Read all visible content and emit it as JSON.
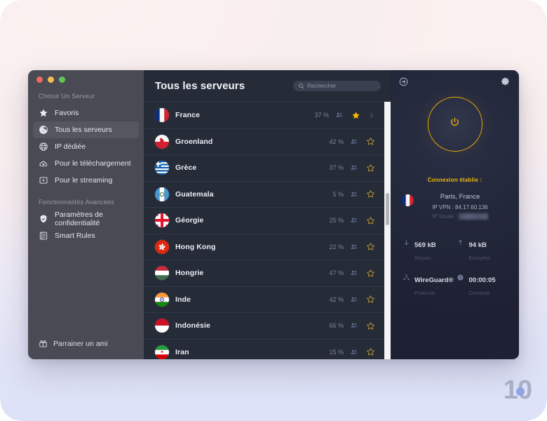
{
  "sidebar": {
    "section_one_title": "Choisir Un Serveur",
    "items_one": [
      {
        "label": "Favoris",
        "icon": "star-icon",
        "active": false
      },
      {
        "label": "Tous les serveurs",
        "icon": "globe-icon",
        "active": true
      },
      {
        "label": "IP dédiée",
        "icon": "dedicated-ip-icon",
        "active": false
      },
      {
        "label": "Pour le téléchargement",
        "icon": "download-cloud-icon",
        "active": false
      },
      {
        "label": "Pour le streaming",
        "icon": "streaming-icon",
        "active": false
      }
    ],
    "section_two_title": "Fonctionnalités Avancées",
    "items_two": [
      {
        "label": "Paramètres de confidentialité",
        "icon": "shield-icon",
        "active": false
      },
      {
        "label": "Smart Rules",
        "icon": "rules-icon",
        "active": false
      }
    ],
    "refer_label": "Parrainer un ami",
    "refer_icon": "gift-icon"
  },
  "main": {
    "title": "Tous les serveurs",
    "search": {
      "value": "",
      "placeholder": "Rechercher",
      "icon": "search-icon"
    },
    "servers": [
      {
        "name": "France",
        "load": "37 %",
        "favorite": true,
        "selected": true,
        "flag": "fr"
      },
      {
        "name": "Groenland",
        "load": "42 %",
        "favorite": false,
        "selected": false,
        "flag": "gl"
      },
      {
        "name": "Grèce",
        "load": "37 %",
        "favorite": false,
        "selected": false,
        "flag": "gr"
      },
      {
        "name": "Guatemala",
        "load": "5 %",
        "favorite": false,
        "selected": false,
        "flag": "gt"
      },
      {
        "name": "Géorgie",
        "load": "25 %",
        "favorite": false,
        "selected": false,
        "flag": "ge"
      },
      {
        "name": "Hong Kong",
        "load": "22 %",
        "favorite": false,
        "selected": false,
        "flag": "hk"
      },
      {
        "name": "Hongrie",
        "load": "47 %",
        "favorite": false,
        "selected": false,
        "flag": "hu"
      },
      {
        "name": "Inde",
        "load": "42 %",
        "favorite": false,
        "selected": false,
        "flag": "in"
      },
      {
        "name": "Indonésie",
        "load": "66 %",
        "favorite": false,
        "selected": false,
        "flag": "id"
      },
      {
        "name": "Iran",
        "load": "15 %",
        "favorite": false,
        "selected": false,
        "flag": "ir"
      }
    ]
  },
  "right_panel": {
    "back_icon": "arrow-right-circle-icon",
    "settings_icon": "gear-icon",
    "power_icon": "power-icon",
    "power_state_color": "#e8a90a",
    "status_text": "Connexion établie :",
    "status_color": "#f2b705",
    "location": "Paris, France",
    "vpn_ip_label": "IP VPN : 84.17.60.136",
    "local_ip_label": "IP locale :",
    "local_ip_value": "10.0.0.000",
    "stats": [
      {
        "icon": "arrow-down-icon",
        "value": "569 kB",
        "label": "Reçues"
      },
      {
        "icon": "arrow-up-icon",
        "value": "94 kB",
        "label": "Envoyées"
      },
      {
        "icon": "protocol-icon",
        "value": "WireGuard®",
        "label": "Protocole"
      },
      {
        "icon": "clock-icon",
        "value": "00:00:05",
        "label": "Connecté"
      }
    ]
  },
  "watermark": {
    "text": "10"
  }
}
